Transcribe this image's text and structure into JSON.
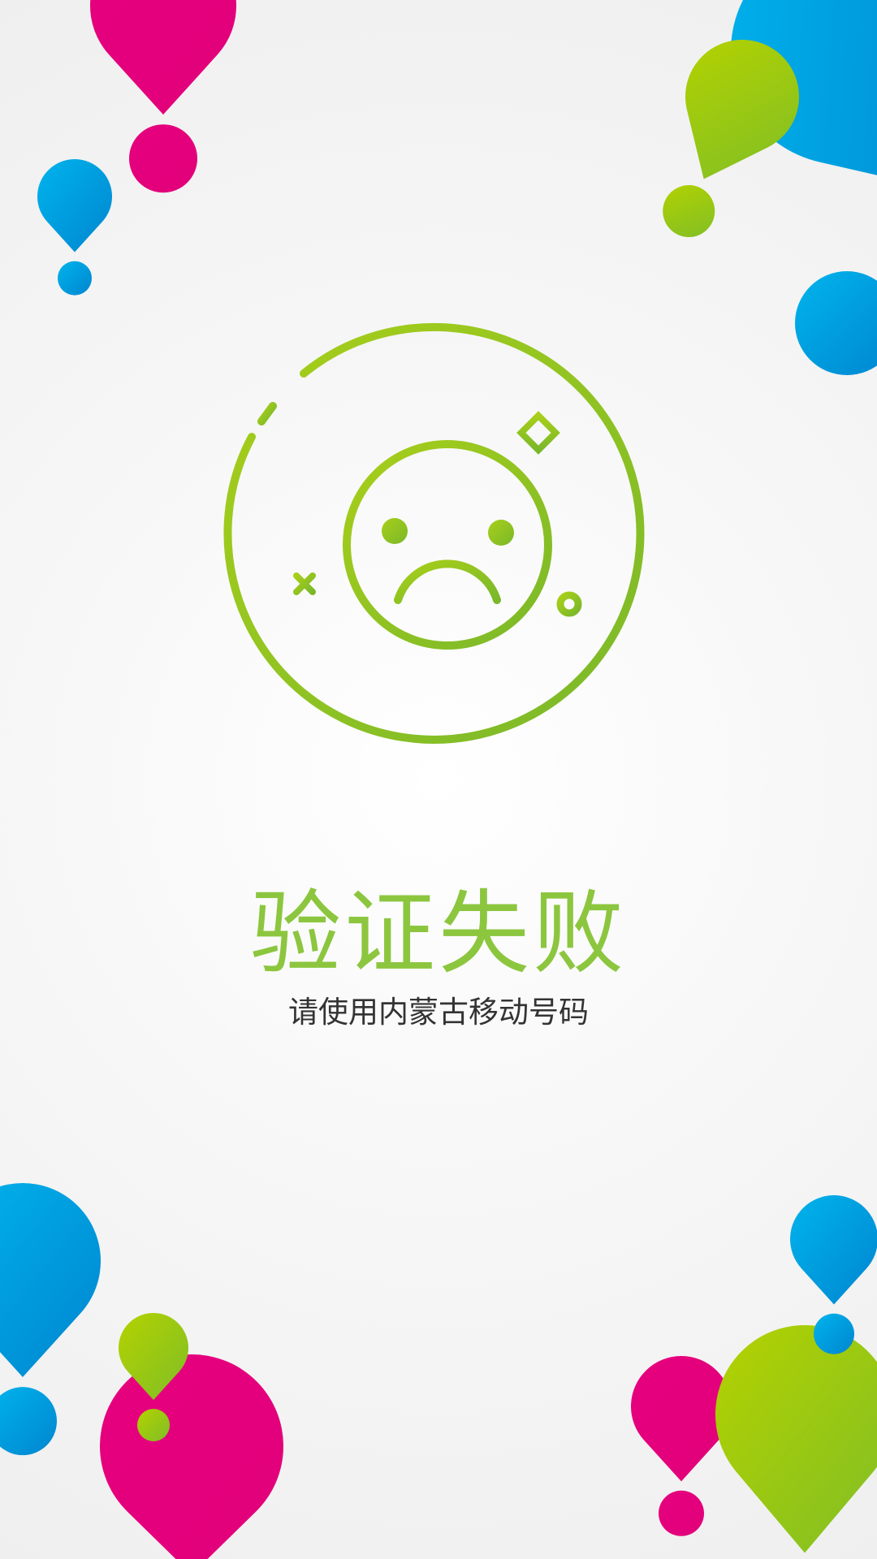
{
  "status": {
    "title": "验证失败",
    "message": "请使用内蒙古移动号码",
    "icon": "sad-face-icon"
  },
  "colors": {
    "accent": "#8cc63f",
    "title": "#8cc63f",
    "message": "#333333",
    "pin_blue": "#0a9fe0",
    "pin_green": "#9bc81c",
    "pin_magenta": "#e6007e"
  },
  "decorations": {
    "pin_icon": "map-pin-icon",
    "pin_colors": [
      "blue",
      "green",
      "magenta"
    ]
  }
}
